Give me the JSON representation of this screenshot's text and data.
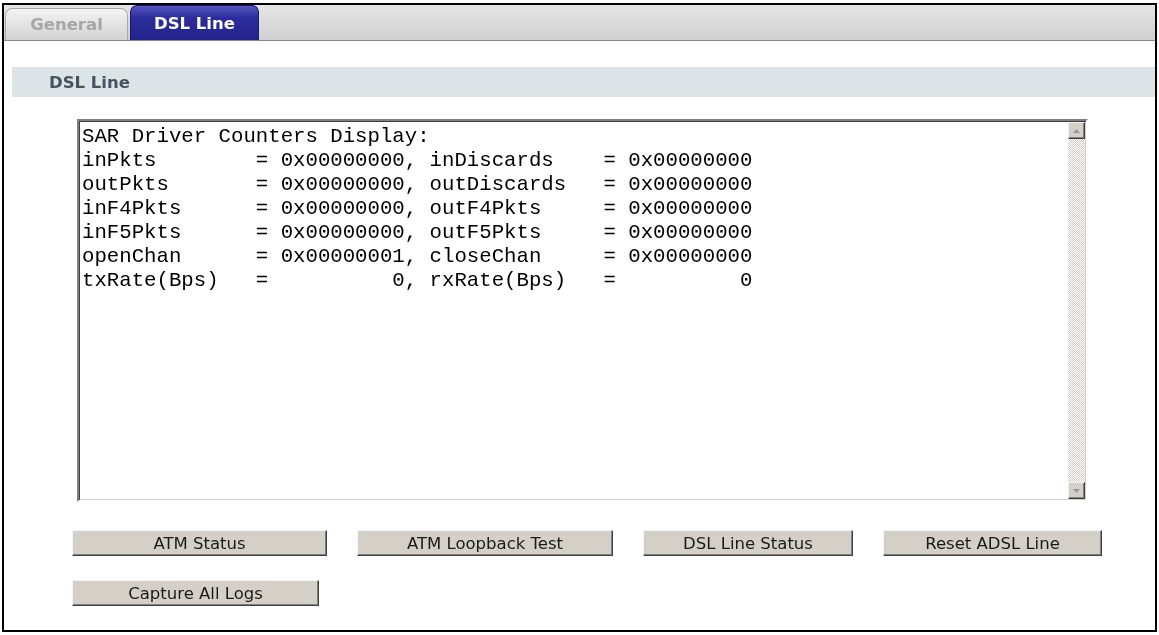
{
  "tabs": [
    {
      "label": "General",
      "selected": false
    },
    {
      "label": "DSL Line",
      "selected": true
    }
  ],
  "section": {
    "title": "DSL Line"
  },
  "counters_display": {
    "value": "SAR Driver Counters Display:\ninPkts        = 0x00000000, inDiscards    = 0x00000000\noutPkts       = 0x00000000, outDiscards   = 0x00000000\ninF4Pkts      = 0x00000000, outF4Pkts     = 0x00000000\ninF5Pkts      = 0x00000000, outF5Pkts     = 0x00000000\nopenChan      = 0x00000001, closeChan     = 0x00000000\ntxRate(Bps)   =          0, rxRate(Bps)   =          0"
  },
  "button_rows": [
    [
      "ATM Status",
      "ATM Loopback Test",
      "DSL Line Status",
      "Reset ADSL Line"
    ],
    [
      "Capture All Logs"
    ]
  ]
}
